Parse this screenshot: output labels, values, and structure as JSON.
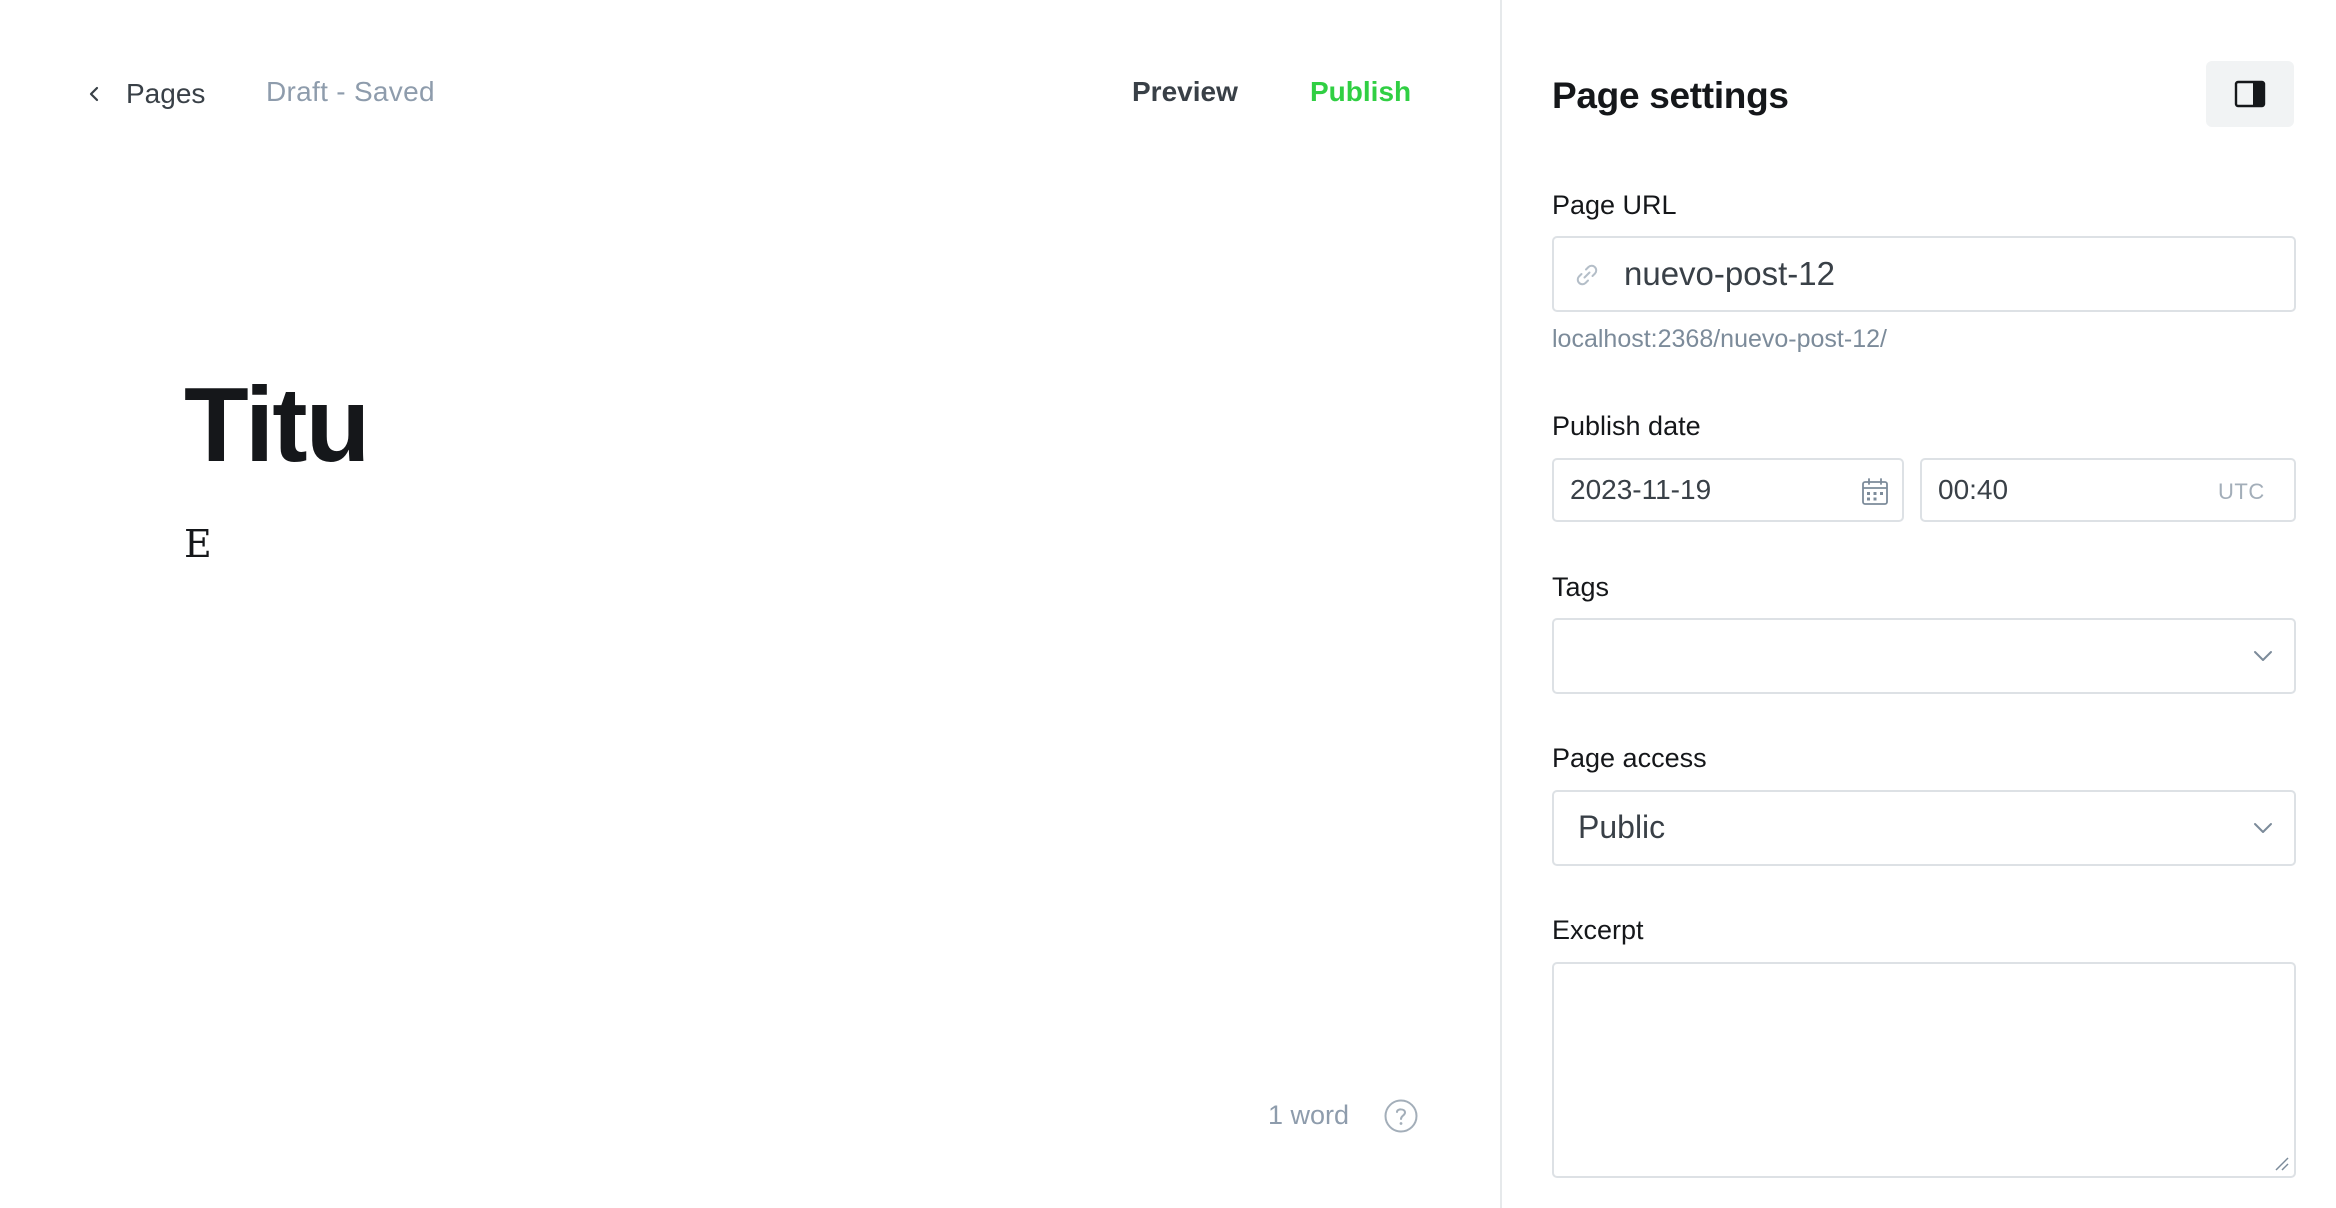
{
  "editor": {
    "back_label": "Pages",
    "status": "Draft - Saved",
    "preview_label": "Preview",
    "publish_label": "Publish",
    "title": "Titu",
    "body": "E",
    "word_count": "1 word"
  },
  "settings": {
    "title": "Page settings",
    "page_url": {
      "label": "Page URL",
      "value": "nuevo-post-12",
      "hint": "localhost:2368/nuevo-post-12/"
    },
    "publish_date": {
      "label": "Publish date",
      "date": "2023-11-19",
      "time": "00:40",
      "timezone": "UTC"
    },
    "tags": {
      "label": "Tags",
      "value": ""
    },
    "page_access": {
      "label": "Page access",
      "value": "Public"
    },
    "excerpt": {
      "label": "Excerpt",
      "value": ""
    }
  },
  "colors": {
    "accent_green": "#30cf43",
    "muted_text": "#8e9cac",
    "border": "#dde1e5"
  },
  "icons": {
    "back": "chevron-left-icon",
    "help": "question-circle-icon",
    "panel_toggle": "sidebar-toggle-icon",
    "url": "link-icon",
    "date": "calendar-icon",
    "dropdown": "chevron-down-icon"
  }
}
